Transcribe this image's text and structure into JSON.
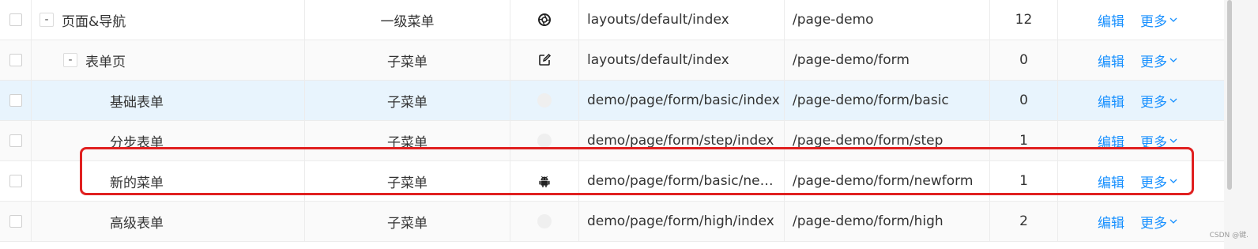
{
  "rows": [
    {
      "expander": "-",
      "name": "页面&导航",
      "type": "一级菜单",
      "icon": "aperture-icon",
      "component": "layouts/default/index",
      "path": "/page-demo",
      "sort": "12",
      "edit": "编辑",
      "more": "更多"
    },
    {
      "expander": "-",
      "name": "表单页",
      "type": "子菜单",
      "icon": "edit-icon",
      "component": "layouts/default/index",
      "path": "/page-demo/form",
      "sort": "0",
      "edit": "编辑",
      "more": "更多"
    },
    {
      "name": "基础表单",
      "type": "子菜单",
      "icon": "none",
      "component": "demo/page/form/basic/index",
      "path": "/page-demo/form/basic",
      "sort": "0",
      "edit": "编辑",
      "more": "更多"
    },
    {
      "name": "分步表单",
      "type": "子菜单",
      "icon": "none",
      "component": "demo/page/form/step/index",
      "path": "/page-demo/form/step",
      "sort": "1",
      "edit": "编辑",
      "more": "更多"
    },
    {
      "name": "新的菜单",
      "type": "子菜单",
      "icon": "android-icon",
      "component": "demo/page/form/basic/newf...",
      "path": "/page-demo/form/newform",
      "sort": "1",
      "edit": "编辑",
      "more": "更多"
    },
    {
      "name": "高级表单",
      "type": "子菜单",
      "icon": "none",
      "component": "demo/page/form/high/index",
      "path": "/page-demo/form/high",
      "sort": "2",
      "edit": "编辑",
      "more": "更多"
    }
  ],
  "watermark": "CSDN @键.",
  "colors": {
    "link": "#1890ff",
    "highlight": "#e02020",
    "selected_row": "#e8f4fd"
  }
}
